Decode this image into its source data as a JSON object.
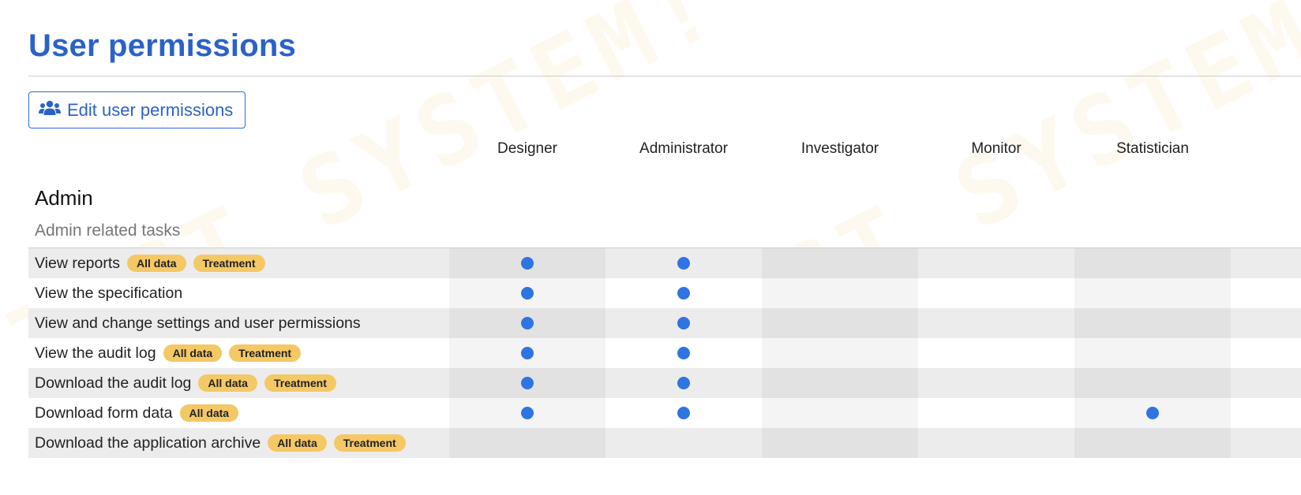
{
  "watermark_text": "TEST SYSTEM!",
  "page": {
    "title": "User permissions",
    "edit_button_label": "Edit user permissions",
    "edit_button_icon": "users-icon"
  },
  "roles": [
    "Designer",
    "Administrator",
    "Investigator",
    "Monitor",
    "Statistician"
  ],
  "section": {
    "title": "Admin",
    "subtitle": "Admin related tasks"
  },
  "permissions": [
    {
      "label": "View reports",
      "badges": [
        "All data",
        "Treatment"
      ],
      "roles": [
        true,
        true,
        false,
        false,
        false
      ]
    },
    {
      "label": "View the specification",
      "badges": [],
      "roles": [
        true,
        true,
        false,
        false,
        false
      ]
    },
    {
      "label": "View and change settings and user permissions",
      "badges": [],
      "roles": [
        true,
        true,
        false,
        false,
        false
      ]
    },
    {
      "label": "View the audit log",
      "badges": [
        "All data",
        "Treatment"
      ],
      "roles": [
        true,
        true,
        false,
        false,
        false
      ]
    },
    {
      "label": "Download the audit log",
      "badges": [
        "All data",
        "Treatment"
      ],
      "roles": [
        true,
        true,
        false,
        false,
        false
      ]
    },
    {
      "label": "Download form data",
      "badges": [
        "All data"
      ],
      "roles": [
        true,
        true,
        false,
        false,
        true
      ]
    },
    {
      "label": "Download the application archive",
      "badges": [
        "All data",
        "Treatment"
      ],
      "roles": [
        false,
        false,
        false,
        false,
        false
      ]
    }
  ],
  "colors": {
    "accent": "#2b62c8",
    "dot": "#2f74e0",
    "badge": "#f4c865"
  }
}
